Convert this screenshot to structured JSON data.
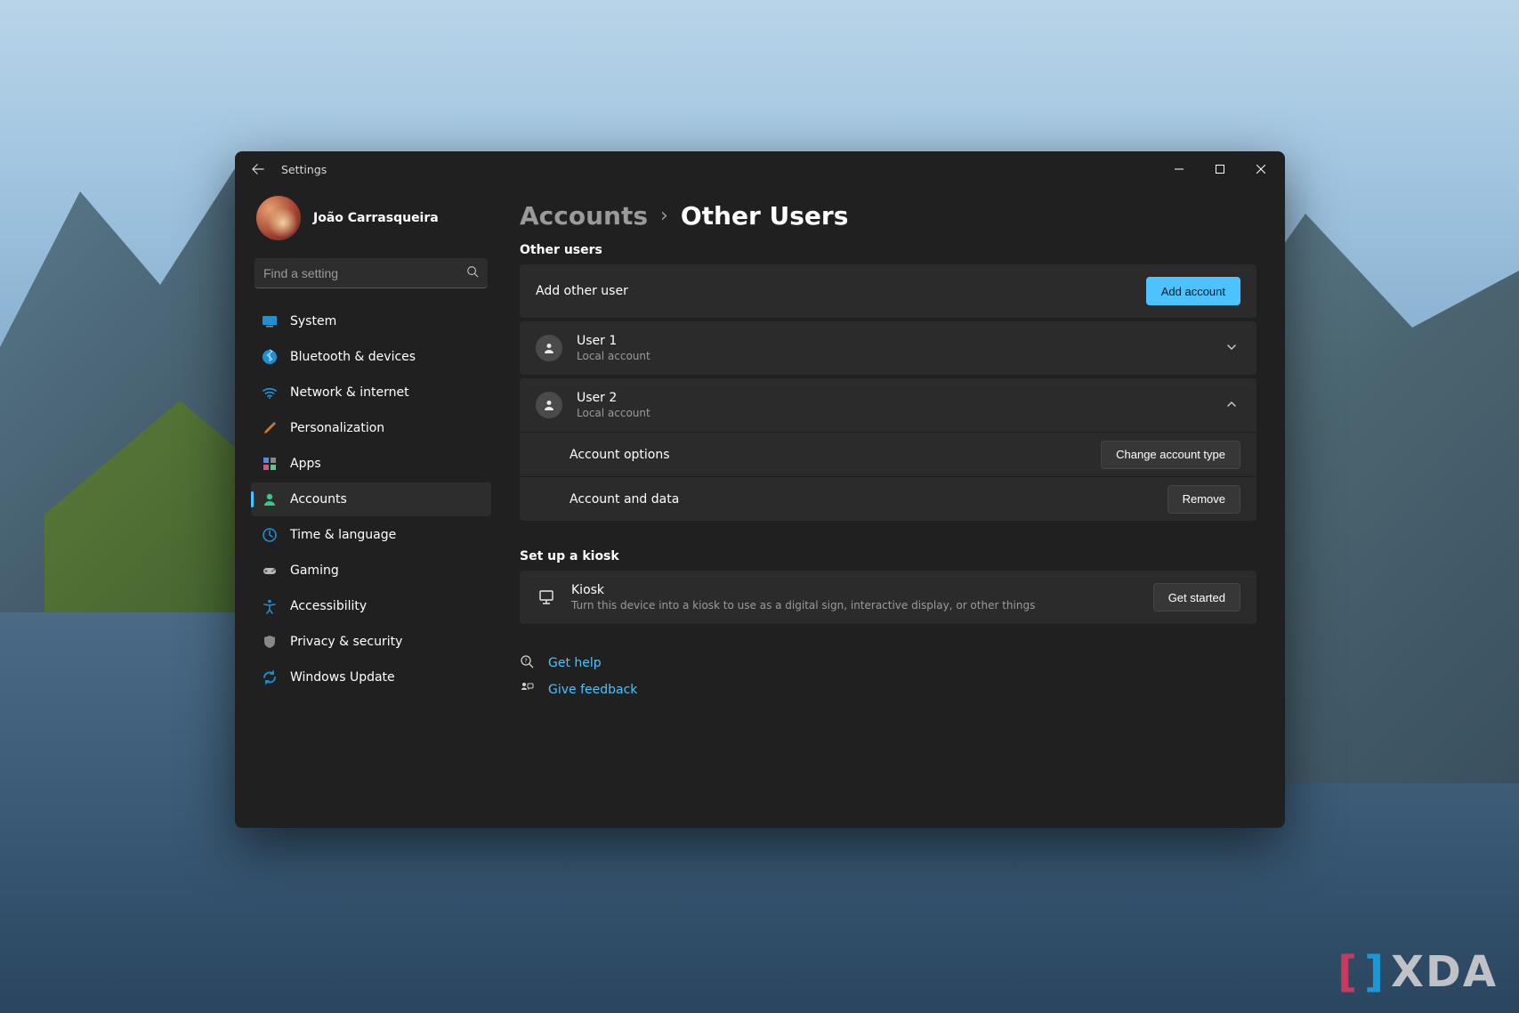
{
  "window": {
    "title": "Settings"
  },
  "user": {
    "name": "João Carrasqueira"
  },
  "search": {
    "placeholder": "Find a setting"
  },
  "sidebar": {
    "items": [
      {
        "label": "System"
      },
      {
        "label": "Bluetooth & devices"
      },
      {
        "label": "Network & internet"
      },
      {
        "label": "Personalization"
      },
      {
        "label": "Apps"
      },
      {
        "label": "Accounts"
      },
      {
        "label": "Time & language"
      },
      {
        "label": "Gaming"
      },
      {
        "label": "Accessibility"
      },
      {
        "label": "Privacy & security"
      },
      {
        "label": "Windows Update"
      }
    ],
    "active_index": 5
  },
  "breadcrumb": {
    "root": "Accounts",
    "current": "Other Users"
  },
  "sections": {
    "other_users": {
      "heading": "Other users",
      "add_row": {
        "label": "Add other user",
        "button": "Add account"
      },
      "users": [
        {
          "name": "User 1",
          "type": "Local account",
          "expanded": false
        },
        {
          "name": "User 2",
          "type": "Local account",
          "expanded": true
        }
      ],
      "expanded_options": {
        "account_options": {
          "label": "Account options",
          "button": "Change account type"
        },
        "account_data": {
          "label": "Account and data",
          "button": "Remove"
        }
      }
    },
    "kiosk": {
      "heading": "Set up a kiosk",
      "title": "Kiosk",
      "subtitle": "Turn this device into a kiosk to use as a digital sign, interactive display, or other things",
      "button": "Get started"
    }
  },
  "footer_links": {
    "help": "Get help",
    "feedback": "Give feedback"
  },
  "watermark": "XDA"
}
